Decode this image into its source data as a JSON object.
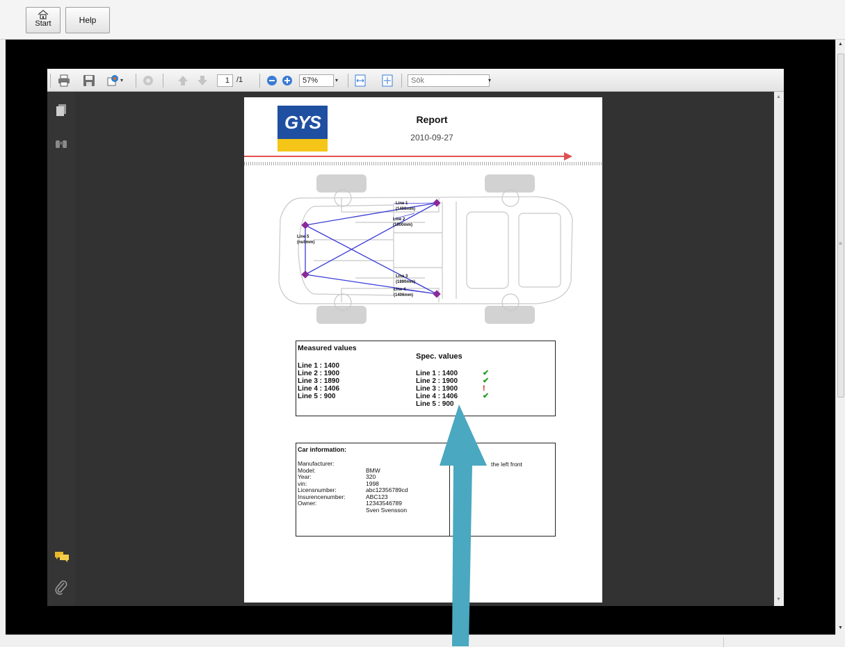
{
  "app_bar": {
    "start_label": "Start",
    "help_label": "Help"
  },
  "viewer": {
    "page_current": "1",
    "page_total": "/1",
    "zoom": "57%",
    "search_placeholder": "Sök"
  },
  "report": {
    "logo_text": "GYS",
    "title": "Report",
    "date": "2010-09-27",
    "diagram_labels": [
      {
        "name": "Line 1",
        "value": "(1400mm)"
      },
      {
        "name": "Line 2",
        "value": "(1900mm)"
      },
      {
        "name": "Line 3",
        "value": "(1890mm)"
      },
      {
        "name": "Line 4",
        "value": "(1406mm)"
      },
      {
        "name": "Line 5",
        "value": "(nullmm)"
      }
    ],
    "measured_header": "Measured values",
    "spec_header": "Spec. values",
    "measured": [
      "Line 1 : 1400",
      "Line 2 : 1900",
      "Line 3 : 1890",
      "Line 4 : 1406",
      "Line 5 : 900"
    ],
    "spec": [
      "Line 1 : 1400",
      "Line 2 : 1900",
      "Line 3 : 1900",
      "Line 4 : 1406",
      "Line 5 : 900"
    ],
    "status": [
      "ok",
      "ok",
      "fail",
      "ok"
    ],
    "car_info_header": "Car information:",
    "car_info": [
      {
        "label": "Manufacturer:",
        "value": ""
      },
      {
        "label": "Model:",
        "value": "BMW"
      },
      {
        "label": "Year:",
        "value": "320"
      },
      {
        "label": "vin:",
        "value": "1998"
      },
      {
        "label": "Licensnumber:",
        "value": "abc12356789cd"
      },
      {
        "label": "Insurencenumber:",
        "value": "ABC123"
      },
      {
        "label": "Owner:",
        "value": "12343546789"
      },
      {
        "label": "",
        "value": "Sven Svensson"
      }
    ],
    "note": "the left front"
  },
  "colors": {
    "accent_arrow": "#4aa8c0",
    "diagram_line": "#3a3ad8",
    "ok": "#1a9b1a",
    "fail": "#d01818"
  }
}
